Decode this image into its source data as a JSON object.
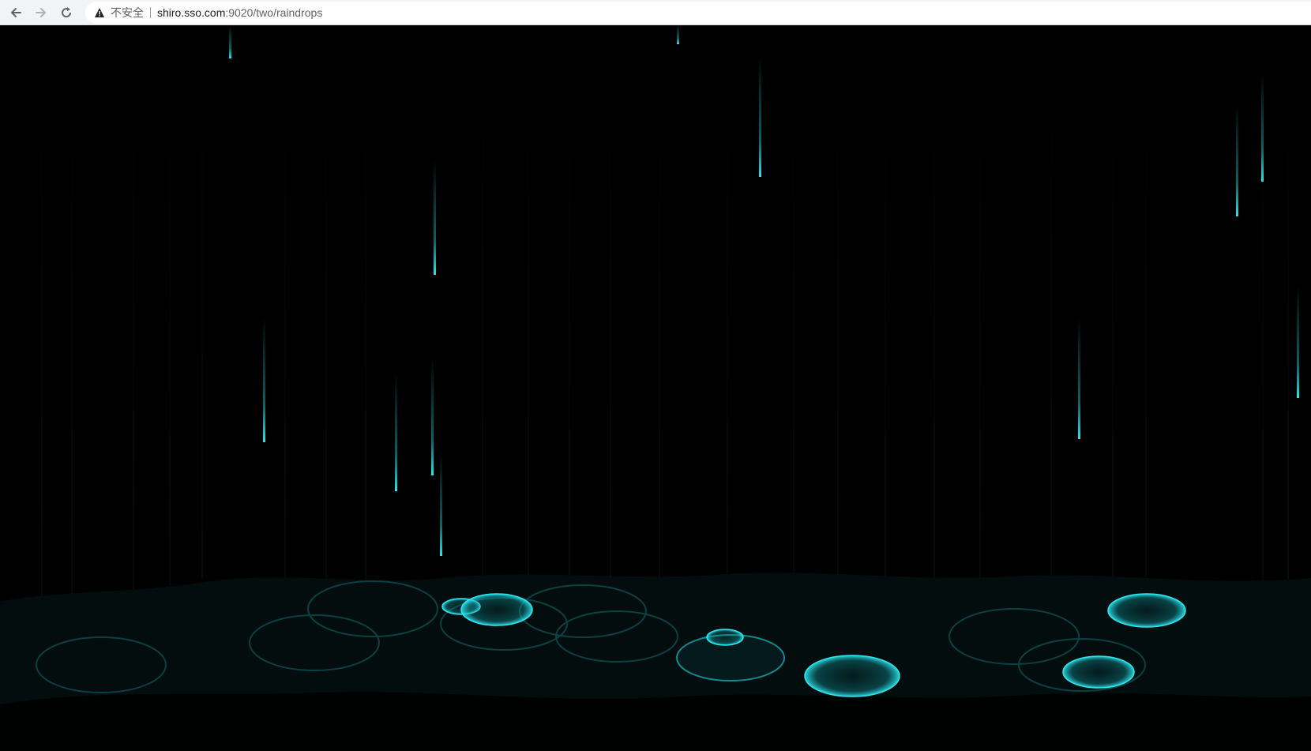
{
  "browser": {
    "security_label": "不安全",
    "url_host": "shiro.sso.com",
    "url_rest": ":9020/two/raindrops",
    "icons": {
      "back": "arrow-left-icon",
      "forward": "arrow-right-icon",
      "reload": "reload-icon",
      "security": "warning-triangle-icon"
    }
  },
  "scene": {
    "background_color": "#000000",
    "accent_color": "#19c6cc",
    "water_color": "#030d0e"
  }
}
